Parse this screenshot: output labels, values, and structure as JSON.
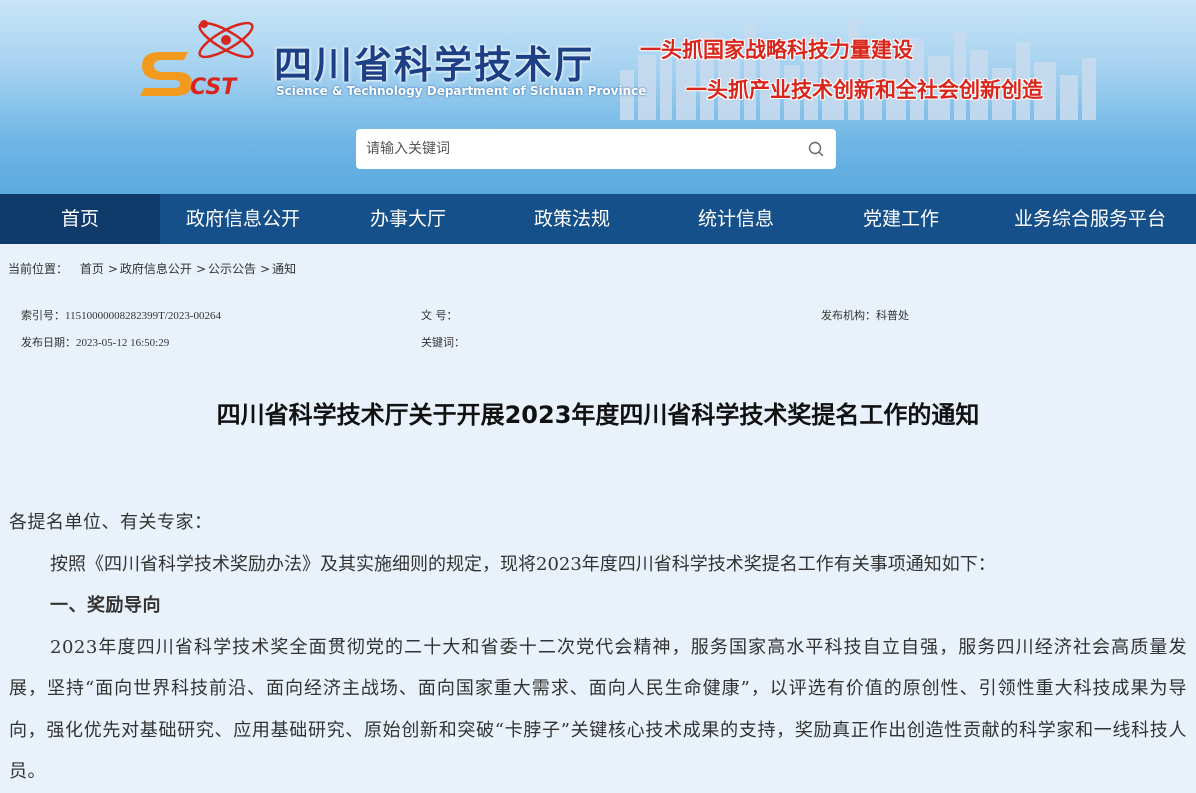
{
  "header": {
    "logo_text": "SCST",
    "site_name": "四川省科学技术厅",
    "site_name_en": "Science & Technology Department of Sichuan Province",
    "slogan_1": "一头抓国家战略科技力量建设",
    "slogan_2": "一头抓产业技术创新和全社会创新创造"
  },
  "search": {
    "placeholder": "请输入关键词",
    "icon": "search-icon"
  },
  "nav": {
    "items": [
      {
        "label": "首页",
        "active": true
      },
      {
        "label": "政府信息公开"
      },
      {
        "label": "办事大厅"
      },
      {
        "label": "政策法规"
      },
      {
        "label": "统计信息"
      },
      {
        "label": "党建工作"
      },
      {
        "label": "业务综合服务平台"
      }
    ]
  },
  "breadcrumb": {
    "prefix": "当前位置：",
    "items": [
      "首页",
      "政府信息公开",
      "公示公告",
      "通知"
    ],
    "separator": ">"
  },
  "meta": {
    "index_label": "索引号：",
    "index_value": "11510000008282399T/2023-00264",
    "doc_no_label": "文 号：",
    "doc_no_value": "",
    "publisher_label": "发布机构：",
    "publisher_value": "科普处",
    "date_label": "发布日期：",
    "date_value": "2023-05-12 16:50:29",
    "keywords_label": "关键词：",
    "keywords_value": ""
  },
  "article": {
    "title": "四川省科学技术厅关于开展2023年度四川省科学技术奖提名工作的通知",
    "salutation": "各提名单位、有关专家：",
    "intro": "按照《四川省科学技术奖励办法》及其实施细则的规定，现将2023年度四川省科学技术奖提名工作有关事项通知如下：",
    "section_1_heading": "一、奖励导向",
    "section_1_body": "2023年度四川省科学技术奖全面贯彻党的二十大和省委十二次党代会精神，服务国家高水平科技自立自强，服务四川经济社会高质量发展，坚持“面向世界科技前沿、面向经济主战场、面向国家重大需求、面向人民生命健康”，以评选有价值的原创性、引领性重大科技成果为导向，强化优先对基础研究、应用基础研究、原始创新和突破“卡脖子”关键核心技术成果的支持，奖励真正作出创造性贡献的科学家和一线科技人员。"
  },
  "colors": {
    "nav_bg": "#16508a",
    "nav_active": "#0f3b6b",
    "page_bg": "#e9f2fb",
    "slogan": "#d9261c",
    "site_name": "#1c3f86"
  }
}
